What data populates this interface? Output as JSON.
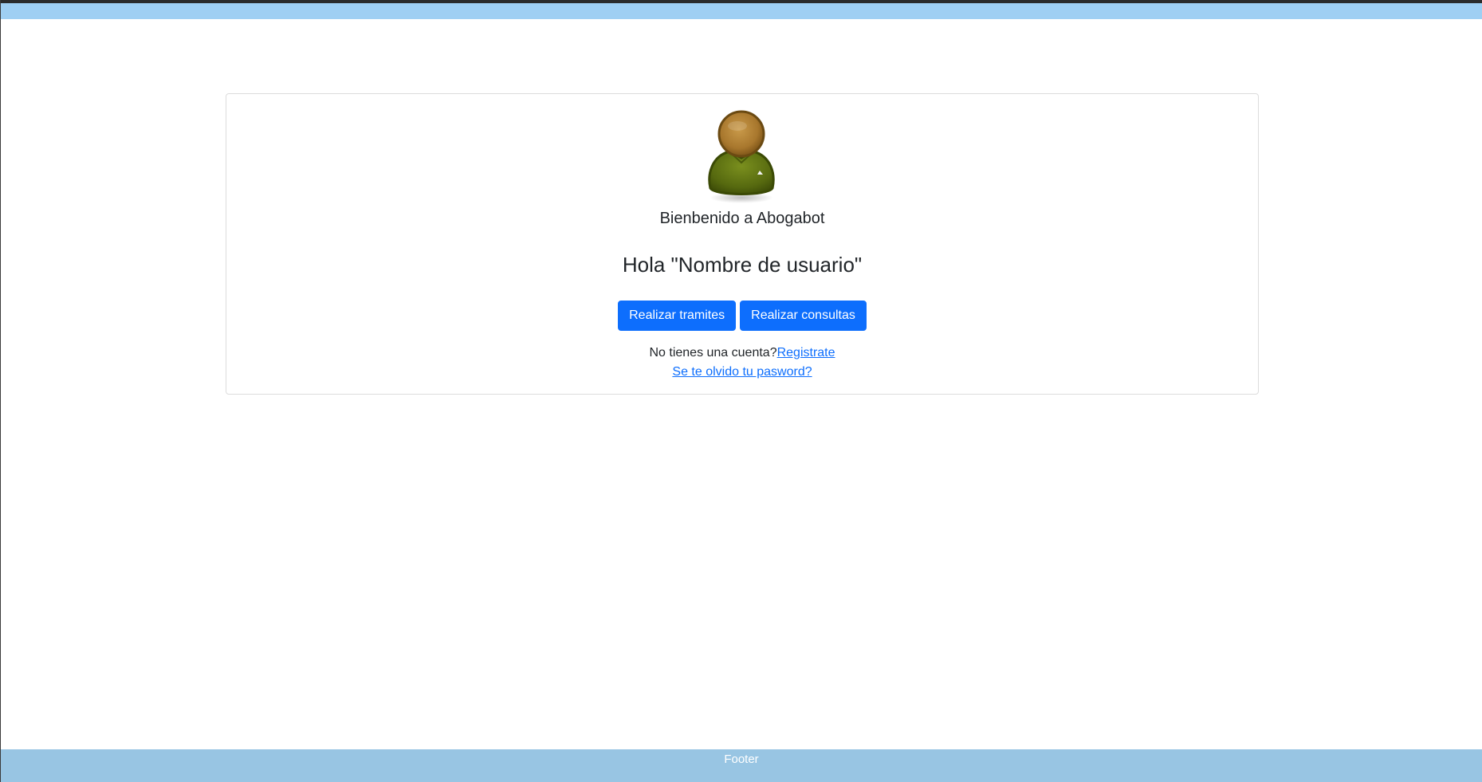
{
  "header": {
    "bar_color": "#9fcff3"
  },
  "card": {
    "avatar_icon": "user-avatar-icon",
    "welcome_text": "Bienbenido a Abogabot",
    "greeting_text": "Hola \"Nombre de usuario\"",
    "buttons": [
      {
        "label": "Realizar tramites"
      },
      {
        "label": "Realizar consultas"
      }
    ],
    "no_account_text": "No tienes una cuenta?",
    "register_link": "Registrate",
    "forgot_link": "Se te olvido tu pasword?"
  },
  "footer": {
    "text": "Footer",
    "bar_color": "#98c5e3"
  },
  "colors": {
    "primary_button": "#0d6efd",
    "link": "#0d6efd"
  }
}
